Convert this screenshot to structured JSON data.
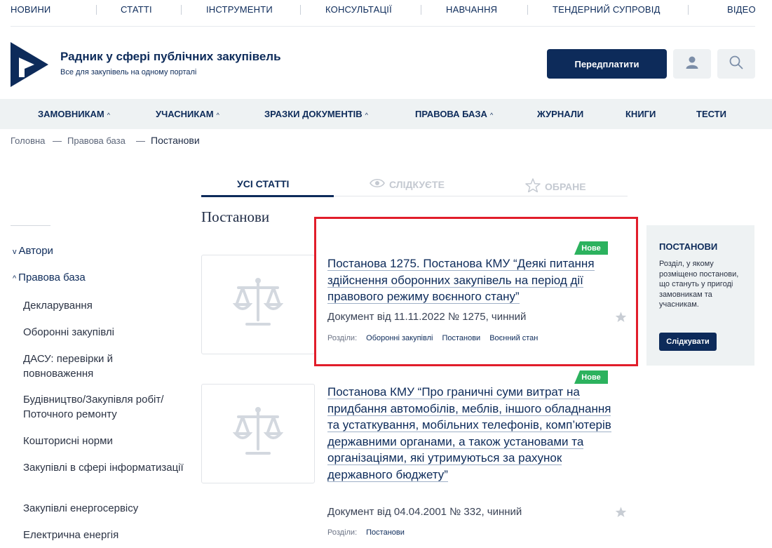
{
  "top_nav": [
    "НОВИНИ",
    "СТАТТІ",
    "ІНСТРУМЕНТИ",
    "КОНСУЛЬТАЦІЇ",
    "НАВЧАННЯ",
    "ТЕНДЕРНИЙ СУПРОВІД",
    "ВІДЕО"
  ],
  "header": {
    "title": "Радник у сфері публічних закупівель",
    "subtitle": "Все для закупівель на одному порталі",
    "subscribe_label": "Передплатити",
    "user_icon": "user-icon",
    "search_icon": "search-icon"
  },
  "main_menu": [
    {
      "label": "ЗАМОВНИКАМ",
      "caret": "^"
    },
    {
      "label": "УЧАСНИКАМ",
      "caret": "^"
    },
    {
      "label": "ЗРАЗКИ ДОКУМЕНТІВ",
      "caret": "^"
    },
    {
      "label": "ПРАВОВА БАЗА",
      "caret": "^"
    },
    {
      "label": "ЖУРНАЛИ",
      "caret": ""
    },
    {
      "label": "КНИГИ",
      "caret": ""
    },
    {
      "label": "ТЕСТИ",
      "caret": ""
    }
  ],
  "breadcrumb": {
    "items": [
      "Головна",
      "Правова база",
      "Постанови"
    ],
    "separator": "—"
  },
  "tabs": [
    {
      "label": "УСІ СТАТТІ",
      "active": true,
      "icon": ""
    },
    {
      "label": "СЛІДКУЄТЕ",
      "active": false,
      "icon": "eye-icon"
    },
    {
      "label": "ОБРАНЕ",
      "active": false,
      "icon": "star-icon"
    }
  ],
  "section_title": "Постанови",
  "sidebar": {
    "top_items": [
      {
        "label": "Автори",
        "caret": "v"
      },
      {
        "label": "Правова база",
        "caret": "^"
      }
    ],
    "sub_items": [
      "Декларування",
      "Оборонні закупівлі",
      "ДАСУ: перевірки й повноваження",
      "Будівництво/Закупівля робіт/ Поточного ремонту",
      "Кошторисні норми",
      "Закупівлі в сфері інформатизації",
      "Закупівлі енергосервісу",
      "Електрична енергія"
    ]
  },
  "articles": [
    {
      "badge": "Нове",
      "title": "Постанова 1275. Постанова КМУ “Деякі питання здійснення оборонних закупівель на період дії правового режиму воєнного стану”",
      "meta": "Документ від 11.11.2022 № 1275, чинний",
      "tags_label": "Розділи:",
      "tags": [
        "Оборонні закупівлі",
        "Постанови",
        "Воєнний стан"
      ]
    },
    {
      "badge": "Нове",
      "title": "Постанова КМУ “Про граничні суми витрат на придбання автомобілів, меблів, іншого обладнання та устаткування, мобільних телефонів, комп’ютерів державними органами, а також установами та організаціями, які утримуються за рахунок державного бюджету”",
      "meta": "Документ від 04.04.2001 № 332, чинний",
      "tags_label": "Розділи:",
      "tags": [
        "Постанови"
      ]
    }
  ],
  "info_box": {
    "title": "ПОСТАНОВИ",
    "text": "Розділ, у якому розміщено постанови, що стануть у пригоді замовникам та учасникам.",
    "button": "Слідкувати"
  },
  "colors": {
    "primary": "#0d2b5a",
    "badge": "#2cb25e",
    "highlight": "#e11d2a",
    "menu_bg": "#eef2f3"
  }
}
